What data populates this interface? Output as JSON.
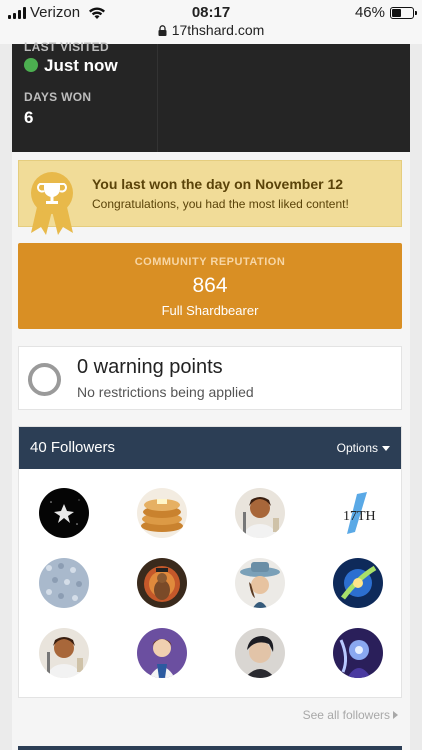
{
  "status_bar": {
    "carrier": "Verizon",
    "time": "08:17",
    "battery": "46%",
    "battery_level": 0.46,
    "url": "17thshard.com"
  },
  "profile": {
    "last_visited_label": "LAST VISITED",
    "last_visited_value": "Just now",
    "days_won_label": "DAYS WON",
    "days_won_value": "6"
  },
  "day_won": {
    "title": "You last won the day on November 12",
    "subtitle": "Congratulations, you had the most liked content!",
    "icon": "trophy-ribbon-icon"
  },
  "reputation": {
    "label": "COMMUNITY REPUTATION",
    "value": "864",
    "rank": "Full Shardbearer"
  },
  "warnings": {
    "title": "0 warning points",
    "subtitle": "No restrictions being applied"
  },
  "followers": {
    "title": "40 Followers",
    "options_label": "Options",
    "see_all": "See all followers",
    "logo_text": "17TH"
  },
  "colors": {
    "online": "#4caf50",
    "day_won_bg": "#f1dc98",
    "reputation_bg": "#d98f24",
    "followers_header": "#2c3e55"
  }
}
